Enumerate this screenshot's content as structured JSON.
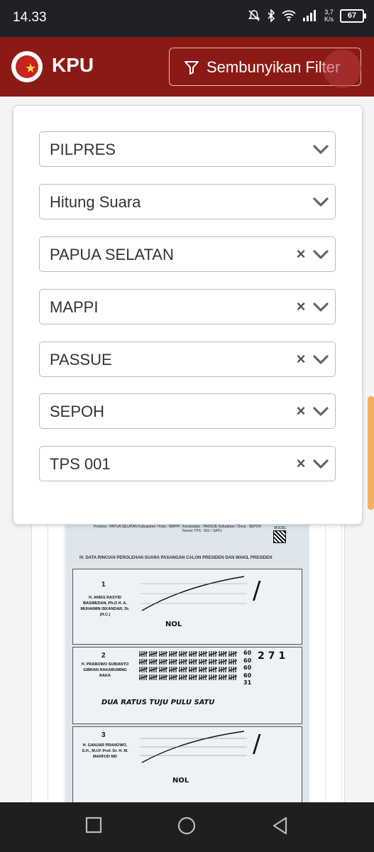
{
  "status_bar": {
    "time": "14.33",
    "net_speed_top": "3,7",
    "net_speed_bottom": "K/s",
    "battery": "67"
  },
  "header": {
    "brand": "KPU",
    "logo_icon": "kpu-logo",
    "filter_button_label": "Sembunyikan Filter",
    "filter_icon": "funnel-icon"
  },
  "filters": [
    {
      "value": "PILPRES",
      "clearable": false
    },
    {
      "value": "Hitung Suara",
      "clearable": false
    },
    {
      "value": "PAPUA SELATAN",
      "clearable": true
    },
    {
      "value": "MAPPI",
      "clearable": true
    },
    {
      "value": "PASSUE",
      "clearable": true
    },
    {
      "value": "SEPOH",
      "clearable": true
    },
    {
      "value": "TPS 001",
      "clearable": true
    }
  ],
  "document": {
    "section_title": "IV. DATA RINCIAN PEROLEHAN SUARA PASANGAN CALON PRESIDEN DAN WAKIL PRESIDEN",
    "header_left": "Provinsi : PAPUA SELATAN   Kabupaten / Kota : MAPPI",
    "header_right": "Kecamatan : PASSUE   Kelurahan / Desa : SEPOH   Nomor TPS : 001 / SATU",
    "form_code": "MODEL C.HASIL-PPWP",
    "candidates": [
      {
        "number": "1",
        "name": "H. ANIES RASYID BASWEDAN, Ph.D  H. A. MUHAIMIN ISKANDAR, Dr. (H.C.)",
        "handwritten_words": "NOL",
        "tally": "0"
      },
      {
        "number": "2",
        "name": "H. PRABOWO SUBIANTO  GIBRAN RAKABUMING RAKA",
        "handwritten_words": "DUA RATUS TUJU PULU SATU",
        "tally": "271",
        "row_totals": [
          "60",
          "60",
          "60",
          "60",
          "31"
        ]
      },
      {
        "number": "3",
        "name": "H. GANJAR PRANOWO, S.H., M.I.P.  Prof. Dr. H. M. MAHFUD MD",
        "handwritten_words": "NOL",
        "tally": "0"
      }
    ]
  },
  "nav_bar": {
    "recents_icon": "square-recents-icon",
    "home_icon": "circle-home-icon",
    "back_icon": "triangle-back-icon"
  },
  "colors": {
    "header_bg": "#8c1a14",
    "status_bar_bg": "#202124",
    "nav_bar_bg": "#1f1f1f",
    "scroll_thumb": "#f4b061"
  }
}
